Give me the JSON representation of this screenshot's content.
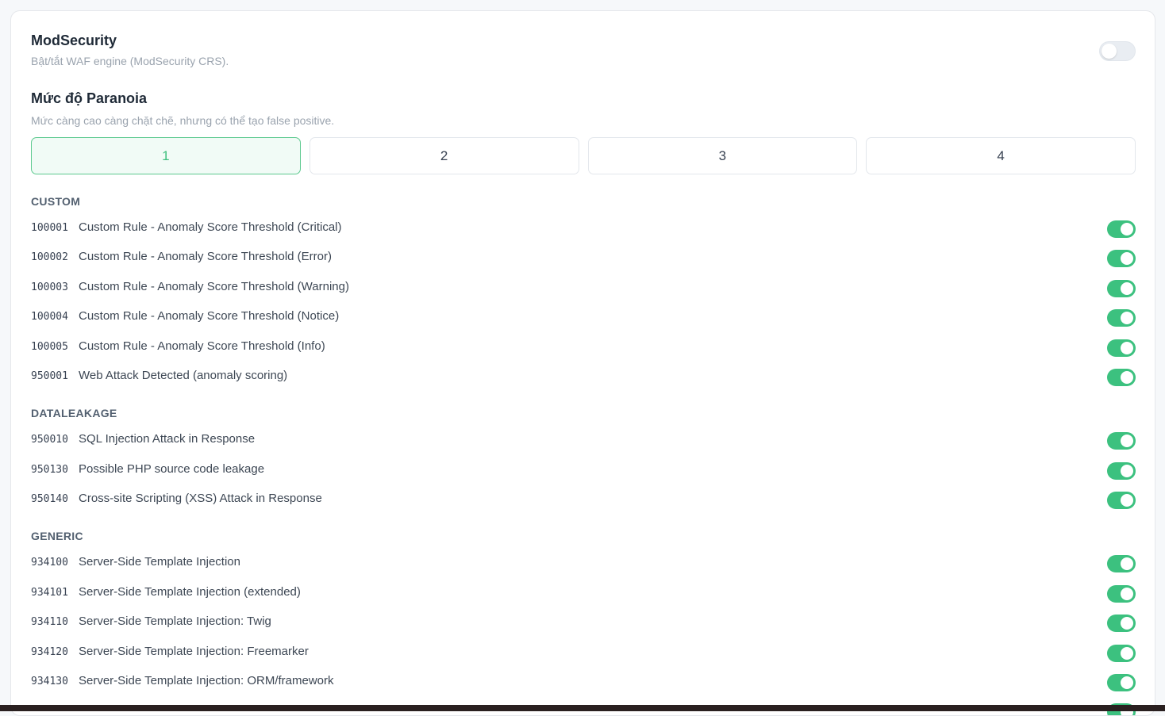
{
  "modsecurity": {
    "title": "ModSecurity",
    "description": "Bật/tắt WAF engine (ModSecurity CRS).",
    "enabled": false
  },
  "paranoia": {
    "title": "Mức độ Paranoia",
    "description": "Mức càng cao càng chặt chẽ, nhưng có thể tạo false positive.",
    "levels": [
      "1",
      "2",
      "3",
      "4"
    ],
    "selected": "1"
  },
  "groups": [
    {
      "name": "CUSTOM",
      "rules": [
        {
          "id": "100001",
          "name": "Custom Rule - Anomaly Score Threshold (Critical)",
          "enabled": true
        },
        {
          "id": "100002",
          "name": "Custom Rule - Anomaly Score Threshold (Error)",
          "enabled": true
        },
        {
          "id": "100003",
          "name": "Custom Rule - Anomaly Score Threshold (Warning)",
          "enabled": true
        },
        {
          "id": "100004",
          "name": "Custom Rule - Anomaly Score Threshold (Notice)",
          "enabled": true
        },
        {
          "id": "100005",
          "name": "Custom Rule - Anomaly Score Threshold (Info)",
          "enabled": true
        },
        {
          "id": "950001",
          "name": "Web Attack Detected (anomaly scoring)",
          "enabled": true
        }
      ]
    },
    {
      "name": "DATALEAKAGE",
      "rules": [
        {
          "id": "950010",
          "name": "SQL Injection Attack in Response",
          "enabled": true
        },
        {
          "id": "950130",
          "name": "Possible PHP source code leakage",
          "enabled": true
        },
        {
          "id": "950140",
          "name": "Cross-site Scripting (XSS) Attack in Response",
          "enabled": true
        }
      ]
    },
    {
      "name": "GENERIC",
      "rules": [
        {
          "id": "934100",
          "name": "Server-Side Template Injection",
          "enabled": true
        },
        {
          "id": "934101",
          "name": "Server-Side Template Injection (extended)",
          "enabled": true
        },
        {
          "id": "934110",
          "name": "Server-Side Template Injection: Twig",
          "enabled": true
        },
        {
          "id": "934120",
          "name": "Server-Side Template Injection: Freemarker",
          "enabled": true
        },
        {
          "id": "934130",
          "name": "Server-Side Template Injection: ORM/framework",
          "enabled": true
        }
      ]
    }
  ],
  "colors": {
    "accent": "#3cc17f",
    "toggle_off": "#e9edf2"
  }
}
